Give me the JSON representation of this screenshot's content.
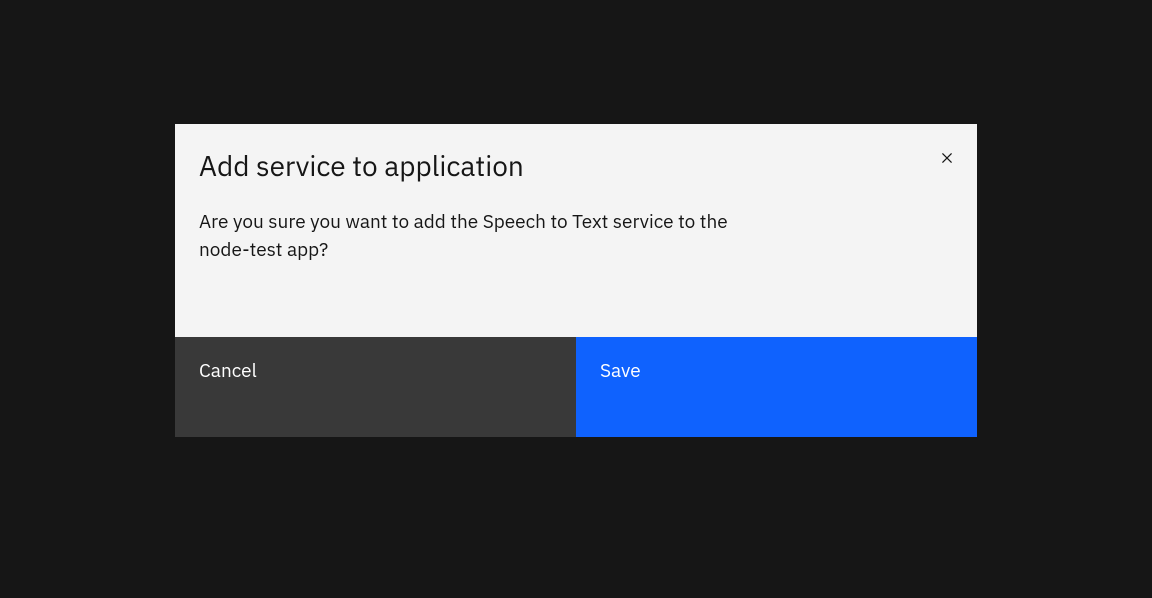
{
  "modal": {
    "title": "Add service to application",
    "description": "Are you sure you want to add the Speech to Text service to the node-test app?",
    "cancel_label": "Cancel",
    "save_label": "Save"
  },
  "colors": {
    "background": "#161616",
    "modal_bg": "#f4f4f4",
    "text": "#161616",
    "secondary_btn": "#393939",
    "primary_btn": "#0f62fe",
    "btn_text": "#ffffff"
  }
}
